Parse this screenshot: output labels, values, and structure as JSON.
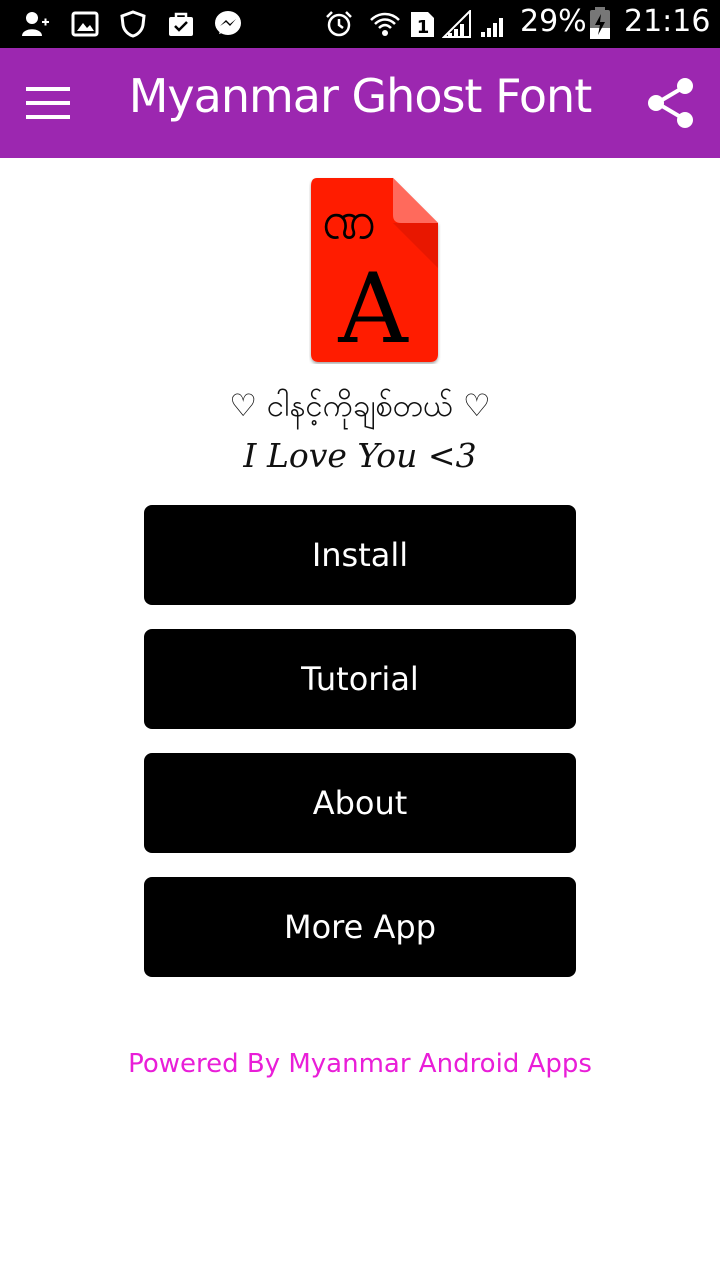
{
  "status_bar": {
    "battery": "29%",
    "time": "21:16",
    "icons": [
      "person-add-icon",
      "image-icon",
      "shield-icon",
      "shopping-bag-icon",
      "messenger-icon",
      "alarm-icon",
      "wifi-icon",
      "sim-1-icon",
      "signal-icon",
      "signal-2-icon",
      "battery-icon"
    ]
  },
  "app_bar": {
    "title": "Myanmar Ghost Font",
    "menu_icon": "menu-icon",
    "share_icon": "share-icon"
  },
  "logo": {
    "glyph_top": "ဏ",
    "glyph_bottom": "A",
    "color": "#FF1A00"
  },
  "tagline": {
    "line1": "♡ ငါနင့်ကိုချစ်တယ် ♡",
    "line2": "I Love You <3"
  },
  "buttons": {
    "install": "Install",
    "tutorial": "Tutorial",
    "about": "About",
    "more_app": "More App"
  },
  "footer": {
    "powered_by": "Powered By Myanmar Android Apps"
  },
  "colors": {
    "app_bar": "#9C27B0",
    "button": "#000000",
    "footer_text": "#E91ED8"
  }
}
